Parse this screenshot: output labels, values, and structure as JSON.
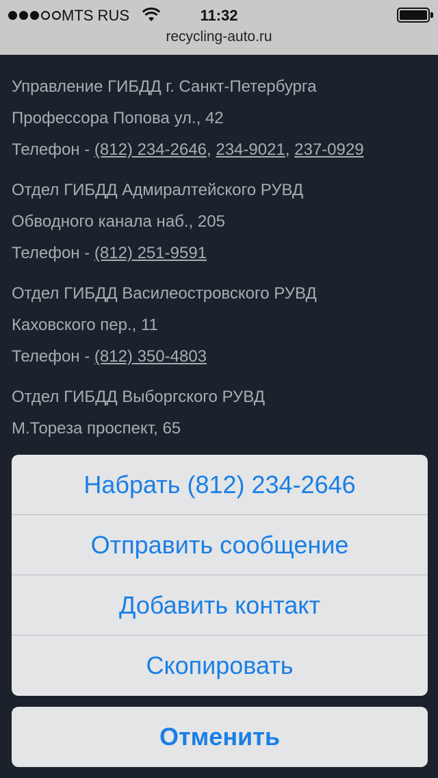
{
  "status_bar": {
    "signal_dots": [
      true,
      true,
      true,
      false,
      false
    ],
    "carrier": "MTS RUS",
    "time": "11:32",
    "url": "recycling-auto.ru",
    "icons": [
      "wifi-icon",
      "battery-icon"
    ]
  },
  "content": {
    "blocks": [
      {
        "name": "Управление ГИБДД г. Санкт-Петербурга",
        "address": "Профессора Попова ул., 42",
        "phone_prefix": "Телефон - ",
        "phones": [
          "(812) 234-2646",
          "234-9021",
          "237-0929"
        ]
      },
      {
        "name": "Отдел ГИБДД Адмиралтейского РУВД",
        "address": "Обводного канала наб., 205",
        "phone_prefix": "Телефон - ",
        "phones": [
          "(812) 251-9591"
        ]
      },
      {
        "name": "Отдел ГИБДД Василеостровского РУВД",
        "address": "Каховского пер., 11",
        "phone_prefix": "Телефон - ",
        "phones": [
          "(812) 350-4803"
        ]
      },
      {
        "name": "Отдел ГИБДД Выборгского РУВД",
        "address": "М.Тореза проспект, 65"
      }
    ]
  },
  "action_sheet": {
    "call": "Набрать (812) 234-2646",
    "message": "Отправить сообщение",
    "add_contact": "Добавить контакт",
    "copy": "Скопировать",
    "cancel": "Отменить"
  },
  "colors": {
    "background": "#1b222c",
    "text": "#a8adb3",
    "accent": "#1a7fe5",
    "sheet": "#e4e5e7"
  }
}
